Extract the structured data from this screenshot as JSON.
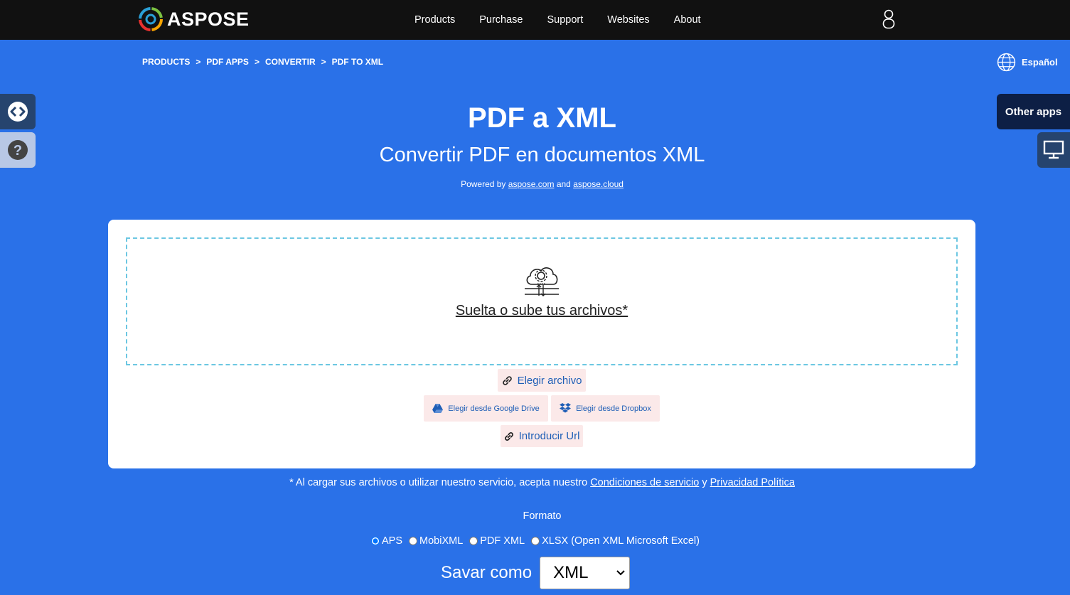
{
  "header": {
    "logo_text": "ASPOSE",
    "nav": [
      "Products",
      "Purchase",
      "Support",
      "Websites",
      "About"
    ]
  },
  "breadcrumb": [
    "PRODUCTS",
    "PDF APPS",
    "CONVERTIR",
    "PDF TO XML"
  ],
  "breadcrumb_separator": ">",
  "language": "Español",
  "sidebar": {
    "other_apps": "Other apps"
  },
  "hero": {
    "title": "PDF a XML",
    "subtitle": "Convertir PDF en documentos XML",
    "powered_prefix": "Powered by",
    "powered_link1": "aspose.com",
    "powered_and": "and",
    "powered_link2": "aspose.cloud"
  },
  "upload": {
    "drop_text": "Suelta o sube tus archivos*",
    "choose_file": "Elegir archivo",
    "google_drive": "Elegir desde Google Drive",
    "dropbox": "Elegir desde Dropbox",
    "enter_url": "Introducir Url"
  },
  "terms": {
    "prefix": "* Al cargar sus archivos o utilizar nuestro servicio, acepta nuestro",
    "link1": "Condiciones de servicio",
    "and": "y",
    "link2": "Privacidad Política"
  },
  "format": {
    "label": "Formato",
    "options": [
      "APS",
      "MobiXML",
      "PDF XML",
      "XLSX (Open XML Microsoft Excel)"
    ],
    "save_as_label": "Savar como",
    "save_as_value": "XML"
  },
  "colors": {
    "background": "#2a71e8",
    "topbar": "#111111",
    "button_bg": "#fbe9e9",
    "button_text": "#1e5eb6",
    "dropzone_border": "#6cc7e2"
  },
  "icons": {
    "logo": "aspose-swirl-logo",
    "user": "user-icon",
    "globe": "globe-icon",
    "code": "code-icon",
    "help": "help-icon",
    "monitor": "monitor-icon",
    "cloud": "cloud-upload-icon",
    "link": "link-icon",
    "drive": "google-drive-icon",
    "dropbox": "dropbox-icon",
    "chevron": "chevron-down-icon"
  }
}
